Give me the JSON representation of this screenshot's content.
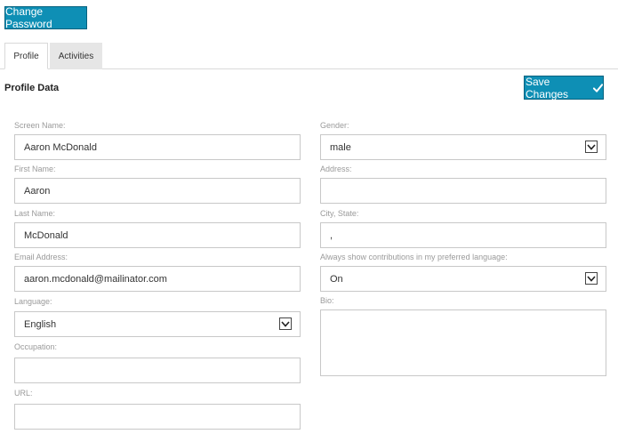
{
  "header": {
    "change_password_label": "Change Password"
  },
  "tabs": [
    {
      "label": "Profile",
      "active": true
    },
    {
      "label": "Activities",
      "active": false
    }
  ],
  "section": {
    "title": "Profile Data",
    "save_label": "Save Changes"
  },
  "form": {
    "screen_name": {
      "label": "Screen Name:",
      "value": "Aaron McDonald"
    },
    "first_name": {
      "label": "First Name:",
      "value": "Aaron"
    },
    "last_name": {
      "label": "Last Name:",
      "value": "McDonald"
    },
    "email": {
      "label": "Email Address:",
      "value": "aaron.mcdonald@mailinator.com"
    },
    "language": {
      "label": "Language:",
      "value": "English"
    },
    "occupation": {
      "label": "Occupation:",
      "value": ""
    },
    "url": {
      "label": "URL:",
      "value": ""
    },
    "gender": {
      "label": "Gender:",
      "value": "male"
    },
    "address": {
      "label": "Address:",
      "value": ""
    },
    "city_state": {
      "label": "City, State:",
      "value": ","
    },
    "preferred_language": {
      "label": "Always show contributions in my preferred language:",
      "value": "On"
    },
    "bio": {
      "label": "Bio:",
      "value": ""
    }
  },
  "colors": {
    "accent": "#0e8fb5",
    "accent_border": "#05627f",
    "field_border": "#c8c8c8",
    "label_text": "#9a9a9a",
    "tab_inactive_bg": "#e6e6e6"
  },
  "icons": {
    "save": "checkmark-icon",
    "select": "chevron-down-icon"
  }
}
